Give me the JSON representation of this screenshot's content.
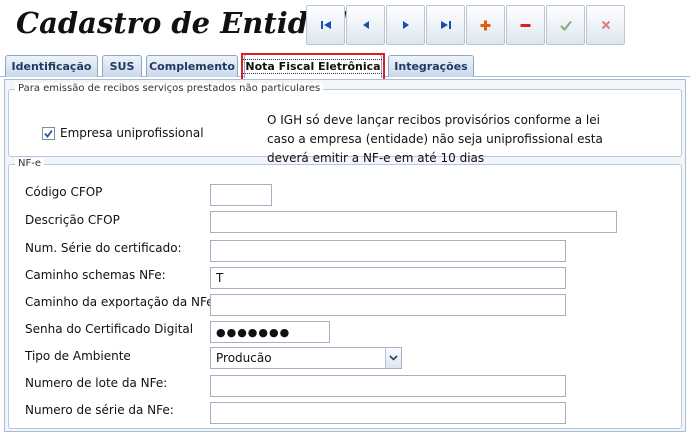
{
  "window": {
    "title": "Cadastro de Entidades"
  },
  "toolbar": [
    {
      "name": "first-record-button",
      "icon": "first-record-icon"
    },
    {
      "name": "previous-record-button",
      "icon": "previous-record-icon"
    },
    {
      "name": "next-record-button",
      "icon": "next-record-icon"
    },
    {
      "name": "last-record-button",
      "icon": "last-record-icon"
    },
    {
      "name": "add-record-button",
      "icon": "plus-icon"
    },
    {
      "name": "remove-record-button",
      "icon": "minus-icon"
    },
    {
      "name": "confirm-button",
      "icon": "check-icon"
    },
    {
      "name": "cancel-button",
      "icon": "close-icon"
    }
  ],
  "tabs": [
    {
      "label": "Identificação",
      "active": false
    },
    {
      "label": "SUS",
      "active": false
    },
    {
      "label": "Complemento",
      "active": false
    },
    {
      "label": "Nota Fiscal Eletrônica",
      "active": true
    },
    {
      "label": "Integrações",
      "active": false
    }
  ],
  "receipts": {
    "legend": "Para emissão de recibos serviços prestados não particulares",
    "checkbox_label": "Empresa uniprofissional",
    "checkbox_checked": true,
    "note_lines": [
      "O IGH só deve lançar recibos provisórios conforme a lei",
      "caso a empresa (entidade) não seja uniprofissional esta",
      "deverá emitir a NF-e em até 10 dias"
    ]
  },
  "nfe": {
    "legend": "NF-e",
    "fields": {
      "cfop_code": {
        "label": "Código CFOP",
        "value": ""
      },
      "cfop_description": {
        "label": "Descrição CFOP",
        "value": ""
      },
      "cert_serial": {
        "label": "Num. Série do certificado:",
        "value": ""
      },
      "schemas_path": {
        "label": "Caminho schemas NFe:",
        "value": "T"
      },
      "export_path": {
        "label": "Caminho da exportação da NFe",
        "value": ""
      },
      "cert_password": {
        "label": "Senha do Certificado Digital",
        "value": "●●●●●●●"
      },
      "environment": {
        "label": "Tipo de Ambiente",
        "value": "Producão"
      },
      "batch_number": {
        "label": "Numero de lote da NFe:",
        "value": ""
      },
      "serial_number": {
        "label": "Numero de série da NFe:",
        "value": ""
      }
    }
  },
  "colors": {
    "nav_icon": "#1c4fa8",
    "add_icon": "#e85d0c",
    "remove_icon": "#d8201c",
    "check_icon": "#7fae74",
    "close_icon": "#e07f7f",
    "highlight": "#d61f26"
  }
}
